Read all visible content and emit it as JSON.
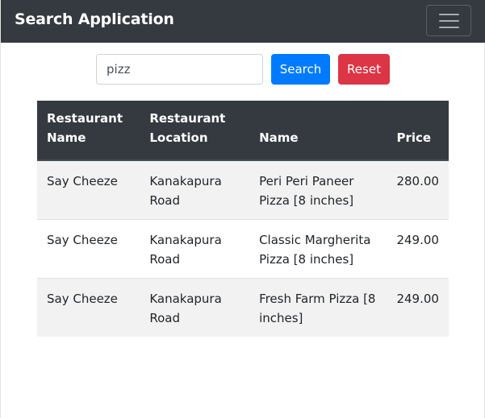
{
  "app": {
    "title": "Search Application"
  },
  "navbar": {
    "toggler_icon": "hamburger-menu-icon"
  },
  "search": {
    "value": "pizz",
    "button_label": "Search",
    "reset_label": "Reset"
  },
  "colors": {
    "navbar": "#343a40",
    "search_button": "#007bff",
    "reset_button": "#dc3545"
  },
  "table": {
    "headers": [
      "Restaurant Name",
      "Restaurant Location",
      "Name",
      "Price"
    ],
    "rows": [
      [
        "Say Cheeze",
        "Kanakapura Road",
        "Peri Peri Paneer Pizza [8 inches]",
        "280.00"
      ],
      [
        "Say Cheeze",
        "Kanakapura Road",
        "Classic Margherita Pizza [8 inches]",
        "249.00"
      ],
      [
        "Say Cheeze",
        "Kanakapura Road",
        "Fresh Farm Pizza [8 inches]",
        "249.00"
      ]
    ]
  }
}
